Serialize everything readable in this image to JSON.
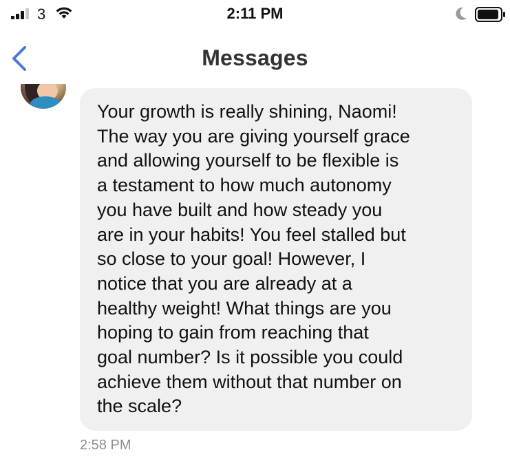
{
  "status_bar": {
    "carrier": "3",
    "time": "2:11 PM",
    "icons": [
      "signal-icon",
      "wifi-icon",
      "moon-icon",
      "battery-icon"
    ]
  },
  "nav": {
    "title": "Messages",
    "back_icon": "chevron-left-icon",
    "accent_color": "#4a78d4"
  },
  "message": {
    "avatar_icon": "avatar",
    "text": "Your growth is really shining, Naomi!\nThe way you are giving yourself grace\nand allowing yourself to be flexible is\na testament to how much autonomy\nyou have built and how steady you\nare in your habits! You feel stalled but\nso close to your goal! However, I\nnotice that you are already at a\nhealthy weight! What things are you\nhoping to gain from reaching that\ngoal number? Is it possible you could\nachieve them without that number on\nthe scale?",
    "timestamp": "2:58 PM",
    "bubble_color": "#f0f0f0"
  }
}
